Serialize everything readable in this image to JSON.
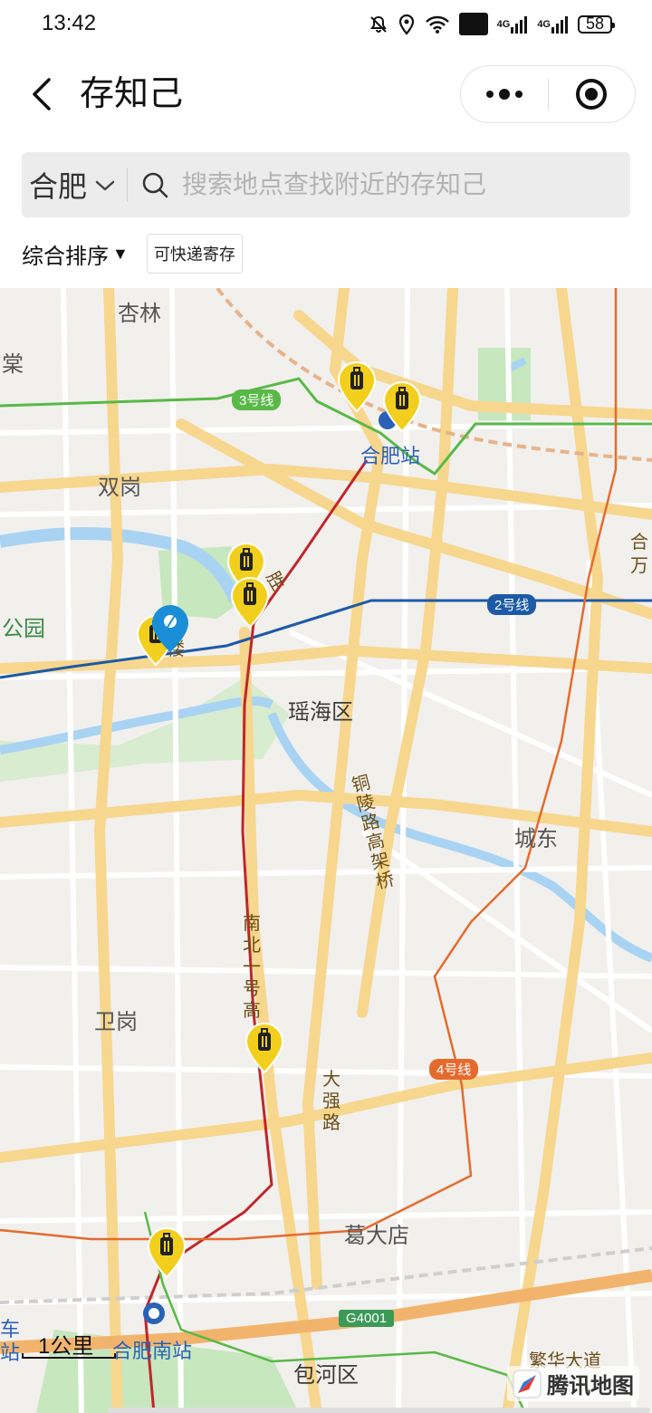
{
  "status_bar": {
    "time": "13:42",
    "icons": [
      "mute-bell-icon",
      "location-icon",
      "wifi-icon",
      "hd-icon",
      "signal-4g-icon",
      "signal-4g-icon",
      "battery-icon"
    ],
    "hd": "HD",
    "net1": "4G",
    "net2": "4G",
    "battery": "58"
  },
  "header": {
    "title": "存知己"
  },
  "search": {
    "city": "合肥",
    "placeholder": "搜索地点查找附近的存知己"
  },
  "filters": {
    "sort_label": "综合排序",
    "sort_arrow": "▼",
    "chip_label": "可快递寄存"
  },
  "map": {
    "place_labels": [
      "杏林",
      "棠",
      "双岗",
      "合肥站",
      "公园",
      "瑶海区",
      "城东",
      "卫岗",
      "葛大店",
      "包河区",
      "合肥南站",
      "车",
      "站",
      "合",
      "万",
      "繁华大道",
      "胜",
      "楼"
    ],
    "road_labels": {
      "tongling": "铜陵路高架桥",
      "nanbei": "南北一号高",
      "daqiang": "大强路"
    },
    "line_badges": {
      "line3": "3号线",
      "line2": "2号线",
      "line4": "4号线",
      "g4001": "G4001"
    },
    "colors": {
      "line3": "#58b947",
      "line2": "#1c5aa6",
      "line4": "#e46b2d",
      "line1": "#c0262b",
      "pin": "#f2cf1d",
      "user_pin": "#1a8fd8",
      "road_major": "#f7d68e",
      "water": "#a9d3f3",
      "park": "#c7e7be"
    },
    "scale_label": "1公里",
    "brand": "腾讯地图"
  }
}
